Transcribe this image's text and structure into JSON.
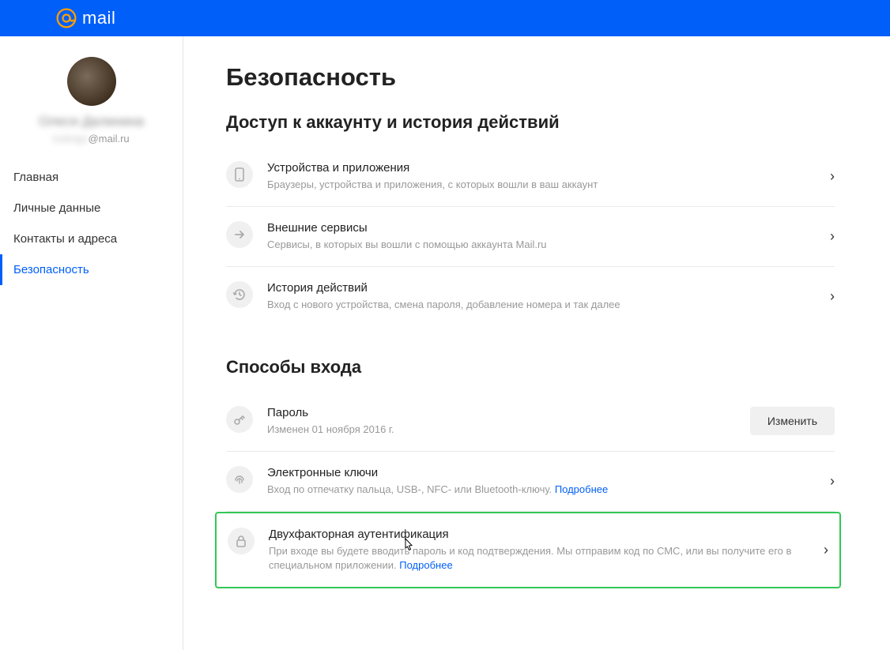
{
  "header": {
    "logo_text": "mail"
  },
  "sidebar": {
    "username": "Олеся Далинина",
    "email_prefix": "kolinigo",
    "email_domain": "@mail.ru",
    "items": [
      {
        "label": "Главная"
      },
      {
        "label": "Личные данные"
      },
      {
        "label": "Контакты и адреса"
      },
      {
        "label": "Безопасность"
      }
    ]
  },
  "main": {
    "page_title": "Безопасность",
    "sections": [
      {
        "heading": "Доступ к аккаунту и история действий",
        "rows": [
          {
            "title": "Устройства и приложения",
            "desc": "Браузеры, устройства и приложения, с которых вошли в ваш аккаунт"
          },
          {
            "title": "Внешние сервисы",
            "desc": "Сервисы, в которых вы вошли с помощью аккаунта Mail.ru"
          },
          {
            "title": "История действий",
            "desc": "Вход с нового устройства, смена пароля, добавление номера и так далее"
          }
        ]
      },
      {
        "heading": "Способы входа",
        "rows": [
          {
            "title": "Пароль",
            "desc": "Изменен 01 ноября 2016 г.",
            "action_label": "Изменить"
          },
          {
            "title": "Электронные ключи",
            "desc": "Вход по отпечатку пальца, USB-, NFC- или Bluetooth-ключу.",
            "more": "Подробнее"
          },
          {
            "title": "Двухфакторная аутентификация",
            "desc": "При входе вы будете вводить пароль и код подтверждения. Мы отправим код по СМС, или вы получите его в специальном приложении.",
            "more": "Подробнее"
          }
        ]
      }
    ]
  }
}
